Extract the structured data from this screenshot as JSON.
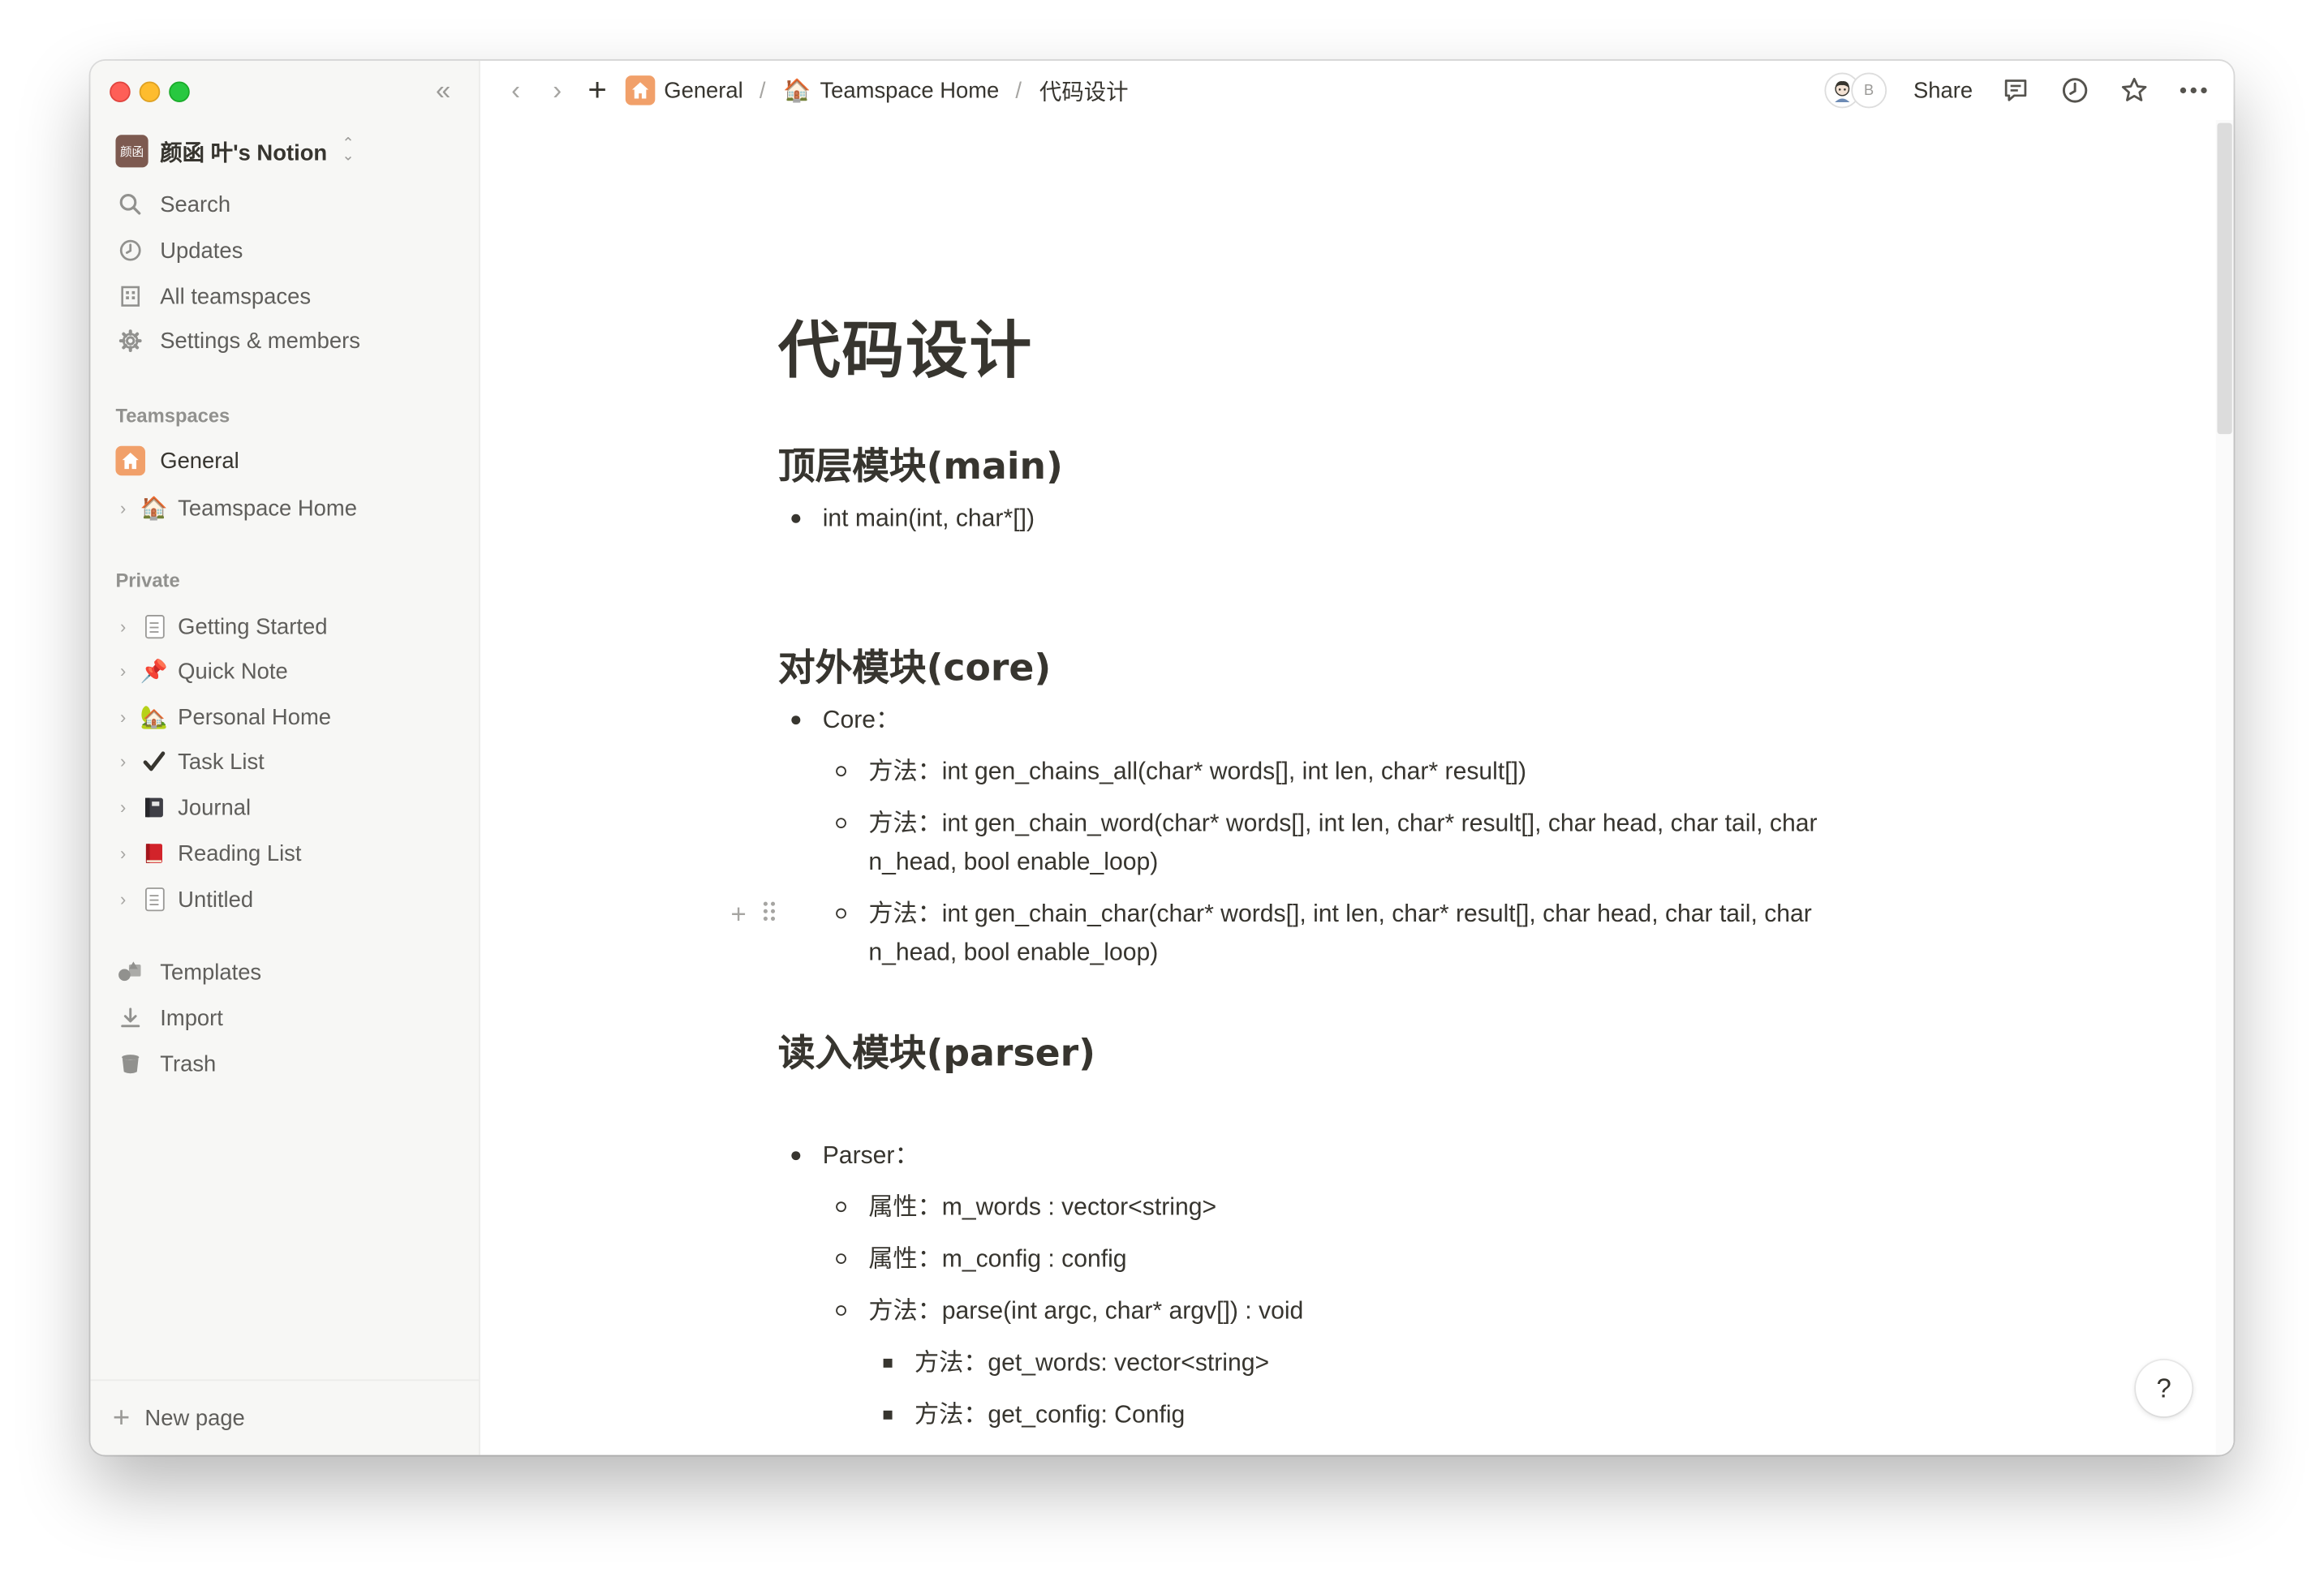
{
  "workspace": {
    "avatar_text": "颜函",
    "name": "颜函 叶's Notion"
  },
  "sidebar": {
    "nav": [
      {
        "label": "Search",
        "icon": "search-icon"
      },
      {
        "label": "Updates",
        "icon": "clock-icon"
      },
      {
        "label": "All teamspaces",
        "icon": "building-icon"
      },
      {
        "label": "Settings & members",
        "icon": "gear-icon"
      }
    ],
    "teamspaces_label": "Teamspaces",
    "teamspaces": [
      {
        "label": "General",
        "icon": "home-icon"
      },
      {
        "label": "Teamspace Home",
        "icon": "house-emoji",
        "emoji": "🏠"
      }
    ],
    "private_label": "Private",
    "private": [
      {
        "label": "Getting Started",
        "icon": "page-icon"
      },
      {
        "label": "Quick Note",
        "icon": "pushpin-emoji",
        "emoji": "📌"
      },
      {
        "label": "Personal Home",
        "icon": "house-tree-emoji",
        "emoji": "🏡"
      },
      {
        "label": "Task List",
        "icon": "checkmark-emoji",
        "emoji": "✔️"
      },
      {
        "label": "Journal",
        "icon": "notebook-emoji",
        "emoji": "📓"
      },
      {
        "label": "Reading List",
        "icon": "book-emoji",
        "emoji": "📕"
      },
      {
        "label": "Untitled",
        "icon": "page-icon"
      }
    ],
    "footer": [
      {
        "label": "Templates",
        "icon": "shapes-icon"
      },
      {
        "label": "Import",
        "icon": "download-icon"
      },
      {
        "label": "Trash",
        "icon": "trash-icon"
      }
    ],
    "new_page": "New page"
  },
  "topbar": {
    "breadcrumbs": [
      "General",
      "Teamspace Home",
      "代码设计"
    ],
    "avatar_letter": "B",
    "share": "Share"
  },
  "doc": {
    "title": "代码设计",
    "sections": [
      {
        "heading": "顶层模块(main)"
      },
      {
        "heading": "对外模块(core)"
      },
      {
        "heading": "读入模块(parser)"
      }
    ],
    "items": {
      "main_1": "int main(int, char*[])",
      "core_1": "Core：",
      "core_1_1": "方法：int gen_chains_all(char* words[], int len, char* result[])",
      "core_1_2a": "方法：int gen_chain_word(char* words[], int len, char* result[], char head, char tail, char",
      "core_1_2b": "n_head, bool enable_loop)",
      "core_1_3a": "方法：int gen_chain_char(char* words[], int len, char* result[], char head, char tail, char",
      "core_1_3b": "n_head, bool enable_loop)",
      "parser_1": "Parser：",
      "parser_1_1": "属性：m_words : vector<string>",
      "parser_1_2": "属性：m_config : config",
      "parser_1_3": "方法：parse(int argc, char* argv[]) : void",
      "parser_1_3_1": "方法：get_words: vector<string>",
      "parser_1_3_2": "方法：get_config: Config"
    }
  },
  "help": "?"
}
